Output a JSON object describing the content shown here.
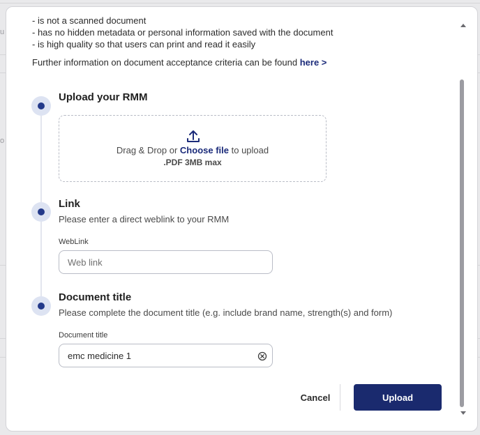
{
  "background": {
    "glyphs": [
      "u",
      "o"
    ]
  },
  "criteria": {
    "items": [
      "- is not a scanned document",
      "- has no hidden metadata or personal information saved with the document",
      "- is high quality so that users can print and read it easily"
    ],
    "further_text": "Further information on document acceptance criteria can be found ",
    "further_link": "here >"
  },
  "steps": {
    "upload": {
      "title": "Upload your RMM",
      "drop_prefix": "Drag & Drop or ",
      "choose_file": "Choose file",
      "drop_suffix": " to upload",
      "max": ".PDF 3MB max"
    },
    "link": {
      "title": "Link",
      "description": "Please enter a direct weblink to your RMM",
      "field_label": "WebLink",
      "placeholder": "Web link",
      "value": ""
    },
    "document_title": {
      "title": "Document title",
      "description": "Please complete the document title (e.g. include brand name, strength(s) and form)",
      "field_label": "Document title",
      "value": "emc medicine 1"
    }
  },
  "actions": {
    "cancel": "Cancel",
    "upload": "Upload"
  },
  "colors": {
    "primary": "#1a2a6e",
    "link": "#1b2b7a",
    "marker_ring": "#dde3f2"
  },
  "icons": {
    "upload": "upload-arrow-icon",
    "clear": "clear-circle-x-icon"
  }
}
